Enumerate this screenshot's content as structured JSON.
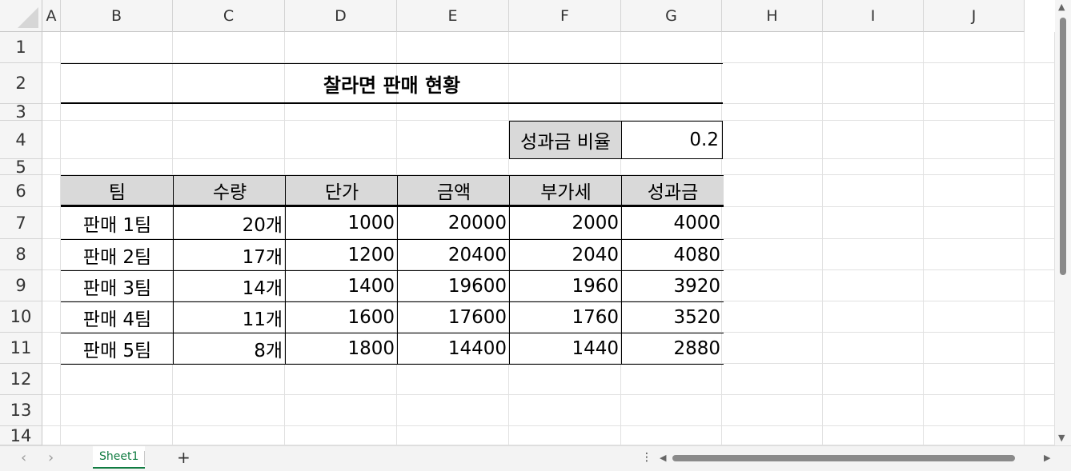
{
  "columns": [
    "A",
    "B",
    "C",
    "D",
    "E",
    "F",
    "G",
    "H",
    "I",
    "J"
  ],
  "rows": [
    "1",
    "2",
    "3",
    "4",
    "5",
    "6",
    "7",
    "8",
    "9",
    "10",
    "11",
    "12",
    "13",
    "14"
  ],
  "title": "찰라면 판매 현황",
  "bonus": {
    "label": "성과금 비율",
    "value": "0.2"
  },
  "table": {
    "headers": [
      "팀",
      "수량",
      "단가",
      "금액",
      "부가세",
      "성과금"
    ],
    "rows": [
      [
        "판매 1팀",
        "20개",
        "1000",
        "20000",
        "2000",
        "4000"
      ],
      [
        "판매 2팀",
        "17개",
        "1200",
        "20400",
        "2040",
        "4080"
      ],
      [
        "판매 3팀",
        "14개",
        "1400",
        "19600",
        "1960",
        "3920"
      ],
      [
        "판매 4팀",
        "11개",
        "1600",
        "17600",
        "1760",
        "3520"
      ],
      [
        "판매 5팀",
        "8개",
        "1800",
        "14400",
        "1440",
        "2880"
      ]
    ]
  },
  "sheet_tab": "Sheet1",
  "add_sheet_label": "+",
  "nav": {
    "prev": "‹",
    "next": "›"
  },
  "scroll": {
    "dots": "⋮",
    "left": "◀",
    "right": "▶",
    "up": "▲",
    "down": "▼"
  },
  "icons": {
    "prev": "chevron-left-icon",
    "next": "chevron-right-icon",
    "add": "plus-icon"
  }
}
